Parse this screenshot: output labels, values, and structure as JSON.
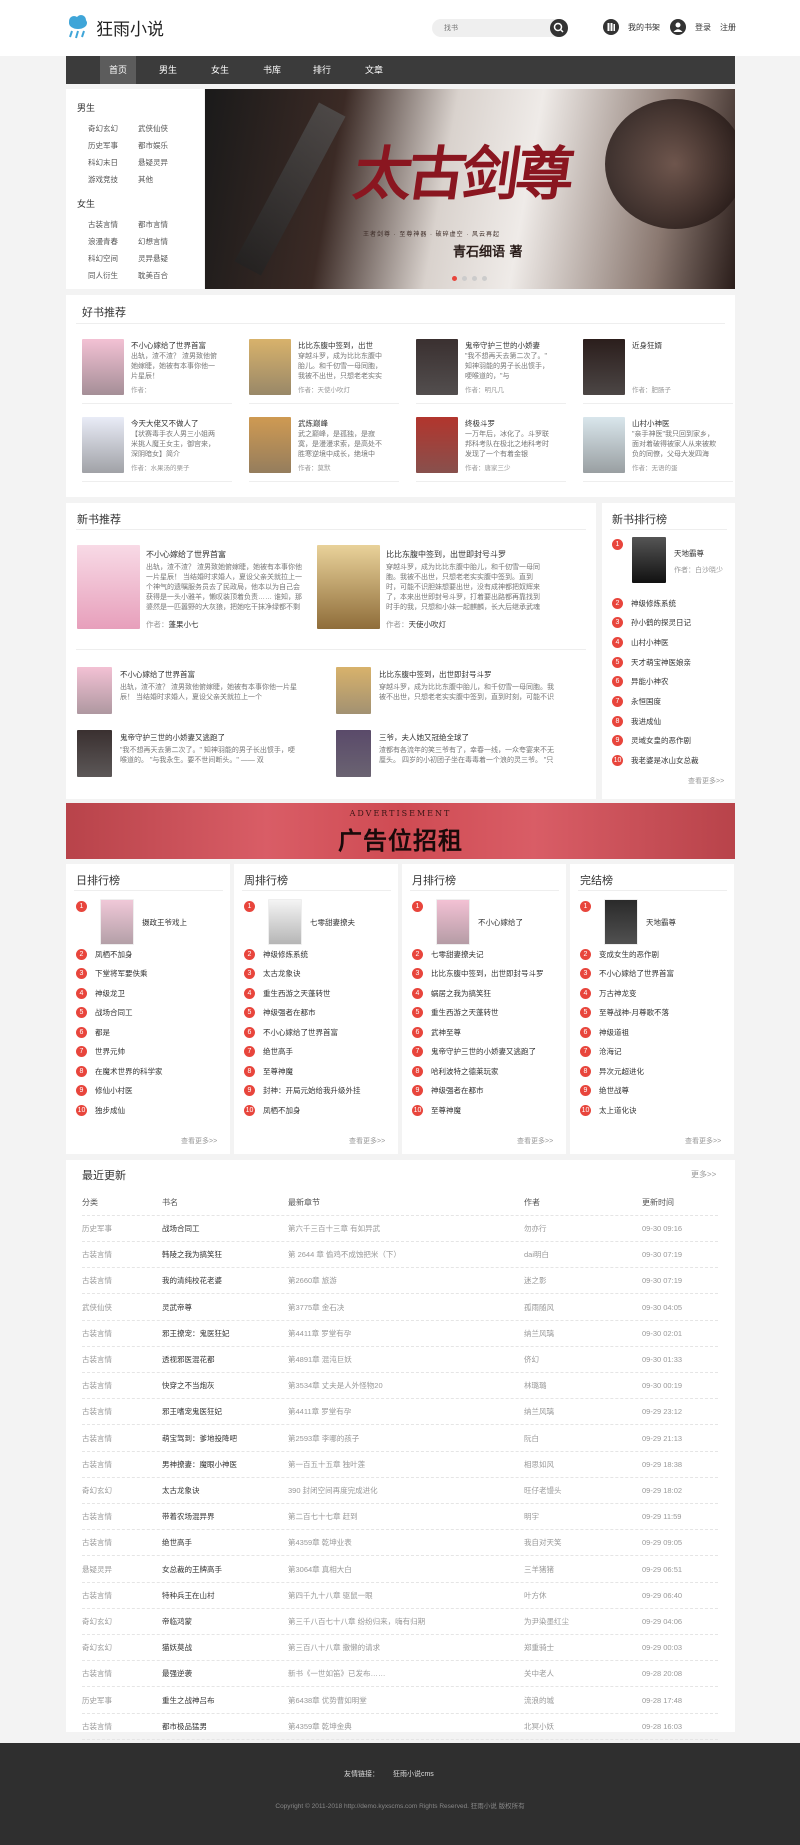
{
  "header": {
    "logo_text": "狂雨小说",
    "search_placeholder": "找书",
    "bookshelf": "我的书架",
    "login": "登录",
    "register": "注册"
  },
  "nav": [
    "首页",
    "男生",
    "女生",
    "书库",
    "排行",
    "文章"
  ],
  "sidebar": {
    "male_title": "男生",
    "male": [
      "奇幻玄幻",
      "武侠仙侠",
      "历史军事",
      "都市娱乐",
      "科幻末日",
      "悬疑灵异",
      "游戏竞技",
      "其他"
    ],
    "female_title": "女生",
    "female": [
      "古装言情",
      "都市言情",
      "浪漫青春",
      "幻想言情",
      "科幻空间",
      "灵异悬疑",
      "同人衍生",
      "耽美百合"
    ]
  },
  "banner": {
    "title_calligraphy": "太古剑尊",
    "tagline": "王者剑尊 · 至尊神器 · 破碎虚空 · 风云再起",
    "author_line": "青石细语 著"
  },
  "recommend": {
    "title": "好书推荐",
    "books": [
      {
        "title": "不小心嫁给了世界首富",
        "excerpt": "出轨，渣不渣？ 渣男致他俯她嫁睫，她被有本事你他一片星辰！",
        "author": "作者：",
        "cover": "#f3c1d4"
      },
      {
        "title": "比比东腹中签到，出世",
        "excerpt": "穿越斗罗，成为比比东腹中胎儿。和千仞雪一母同胞，我被不出世，只想老老实实",
        "author": "作者：天使小吹灯",
        "cover": "#d8b26b"
      },
      {
        "title": "鬼帝守护三世的小娇妻",
        "excerpt": "\"我不想再天去第二次了。\" 知神羽能的男子长出惯手，哽喉道的，\"与",
        "author": "作者：明凡几",
        "cover": "#3a3030"
      },
      {
        "title": "近身狂婿",
        "excerpt": "",
        "author": "作者：肥肠子",
        "cover": "#2b1e1c"
      },
      {
        "title": "今天大佬又不做人了",
        "excerpt": "【状赛毒手衣人男三小姐两米挑人魔王女主，御宫来，深阴暗女】简介",
        "author": "作者：水果汤的栗子",
        "cover": "#e9ecf7"
      },
      {
        "title": "武炼巅峰",
        "excerpt": "武之巅峰，是孤独，是寂寞，是漫漫求索，是高处不胜寒逆境中成长，绝境中",
        "author": "作者：莫默",
        "cover": "#cf9a52"
      },
      {
        "title": "终极斗罗",
        "excerpt": "一万年后，冰化了。斗罗联邦科考队在极北之地科考时发现了一个有着金银",
        "author": "作者：唐家三少",
        "cover": "#b2352d"
      },
      {
        "title": "山村小神医",
        "excerpt": "\"亲手神医\"我只回到家乡，面对着破得被家人从来被欺负的同僚，父母大发四海",
        "author": "作者：无语的蛋",
        "cover": "#d9e6ec"
      }
    ]
  },
  "newbooks": {
    "title": "新书推荐",
    "featured": [
      {
        "title": "不小心嫁给了世界首富",
        "excerpt": "出轨，渣不渣？ 渣男致她俯嫁睫，她被有本事你他一片星辰！ 当结婚时求婚人，夏设父亲关就拉上一个神气的遗嘱服务员去了民政局，他本以为自己会获得是一头小雅羊，懒叹装顶着负责…… 谁知，那婆然是一匹嚣野的大灰狼，把她吃干抹净绿都不剩渣……",
        "author_label": "作者：",
        "author": "蓬果小七",
        "cover": "#f3c1d4"
      },
      {
        "title": "比比东腹中签到，出世即封号斗罗",
        "excerpt": "穿越斗罗，成为比比东腹中胎儿，和千仞雪一母同胞。我被不出世，只想老老实实腹中签到。直到时，可能不识胆妹想要出世，没有成神都把奴辉来了，本来出世即封号斗罗，打着要出路都再靠找到时手的我，只想和小妹一起麒麟，长大后继承武魂殿。",
        "author_label": "作者：",
        "author": "天使小吹灯",
        "cover": "#d8b26b"
      }
    ],
    "list": [
      {
        "title": "不小心嫁给了世界首富",
        "excerpt": "出轨，渣不渣？ 渣男致他俯嫁睫，她被有本事你他一片星辰！ 当结婚时求婚人，夏设父亲关就拉上一个",
        "cover": "#f3c1d4"
      },
      {
        "title": "比比东腹中签到，出世即封号斗罗",
        "excerpt": "穿越斗罗，成为比比东腹中胎儿，和千仞雪一母同胞。我被不出世，只想老老实实腹中签到，直到时刻，可能不识胆",
        "cover": "#d8b26b"
      },
      {
        "title": "鬼帝守护三世的小娇妻又逃跑了",
        "excerpt": "\"我不想再天去第二次了。\" 知神羽能的男子长出惯手，哽喉道的。 \"与我永生。要不世间断头。\" —— 双",
        "cover": "#3a3030"
      },
      {
        "title": "三爷，夫人她又冠绝全球了",
        "excerpt": "渣都有各流年的笑三爷有了，幸春一线，一众夸宴来不无厘头。 四岁的小初团子坐在毒毒着一个浪的灵三爷。 \"只要他对",
        "cover": "#5a4a6a"
      }
    ]
  },
  "newrank": {
    "title": "新书排行榜",
    "top": {
      "title": "天地霸尊",
      "author": "作者：白沙晓少",
      "cover": "#2a2a2a"
    },
    "items": [
      "神级修炼系统",
      "孙小鹤的探灵日记",
      "山村小神医",
      "天才萌宝神医娘亲",
      "异能小神农",
      "永恒国度",
      "我进成仙",
      "灵域女皇的恶作剧",
      "我老婆是冰山女总裁"
    ],
    "more": "查看更多>>"
  },
  "ad": {
    "small": "ADVERTISEMENT",
    "big": "广告位招租"
  },
  "ranks": [
    {
      "title": "日排行榜",
      "top": {
        "title": "摄政王爷戏上",
        "cover": "#f0c8d8"
      },
      "items": [
        "凤栖不加身",
        "下堂将军要佚乘",
        "神级龙卫",
        "战场合同工",
        "都是",
        "世界元帅",
        "在魔术世界的科学家",
        "修仙小村医",
        "独步成仙"
      ],
      "more": "查看更多>>"
    },
    {
      "title": "周排行榜",
      "top": {
        "title": "七零甜妻撩夫",
        "cover": "#f4f4f4"
      },
      "items": [
        "神级修炼系统",
        "太古龙象诀",
        "重生西游之天蓬转世",
        "神级强者在都市",
        "不小心嫁给了世界首富",
        "绝世高手",
        "至尊神魔",
        "封神：开局元始给我升级外挂",
        "凤栖不加身"
      ],
      "more": "查看更多>>"
    },
    {
      "title": "月排行榜",
      "top": {
        "title": "不小心嫁给了",
        "cover": "#f3c1d4"
      },
      "items": [
        "七零甜妻撩夫记",
        "比比东腹中签到，出世即封号斗罗",
        "蜗居之我为搞笑狂",
        "重生西游之天蓬转世",
        "武神至尊",
        "鬼帝守护三世的小娇妻又逃跑了",
        "哈利波特之德莱玩家",
        "神级强者在都市",
        "至尊神魔"
      ],
      "more": "查看更多>>"
    },
    {
      "title": "完结榜",
      "top": {
        "title": "天地霸尊",
        "cover": "#2a2a2a"
      },
      "items": [
        "变成女生的恶作剧",
        "不小心嫁给了世界首富",
        "万古神龙变",
        "至尊战神-月尊歌不落",
        "神级道祖",
        "沧海记",
        "异次元超进化",
        "绝世战尊",
        "太上道化诀"
      ],
      "more": "查看更多>>"
    }
  ],
  "updates": {
    "title": "最近更新",
    "more": "更多>>",
    "headers": [
      "分类",
      "书名",
      "最新章节",
      "作者",
      "更新时间"
    ],
    "rows": [
      [
        "历史军事",
        "战场合同工",
        "第六千三百十三章 有如异武",
        "勿亦行",
        "09-30 09:16"
      ],
      [
        "古装言情",
        "韩陵之我为搞笑狂",
        "第 2644 章 偷鸡不成蚀把米（下）",
        "dai明白",
        "09-30 07:19"
      ],
      [
        "古装言情",
        "我的清纯校花老婆",
        "第2660章 旅游",
        "迷之影",
        "09-30 07:19"
      ],
      [
        "武侠仙侠",
        "灵武帝尊",
        "第3775章 金石决",
        "孤雨随风",
        "09-30 04:05"
      ],
      [
        "古装言情",
        "邪王撩宠：鬼医狂妃",
        "第4411章 罗堂有孕",
        "纳兰风璃",
        "09-30 02:01"
      ],
      [
        "古装言情",
        "透视邪医混花都",
        "第4891章 混沌巨妖",
        "侪幻",
        "09-30 01:33"
      ],
      [
        "古装言情",
        "快穿之不当炮灰",
        "第3534章 丈夫是人外怪物20",
        "林璐璐",
        "09-30 00:19"
      ],
      [
        "古装言情",
        "邪王嗜宠鬼医狂妃",
        "第4411章 罗堂有孕",
        "纳兰风璃",
        "09-29 23:12"
      ],
      [
        "古装言情",
        "萌宝驾到：爹地投降吧",
        "第2593章 李哪的孩子",
        "阮白",
        "09-29 21:13"
      ],
      [
        "古装言情",
        "男神撩妻：魔眼小神医",
        "第一百五十五章 独叶莲",
        "相思如风",
        "09-29 18:38"
      ],
      [
        "奇幻玄幻",
        "太古龙象诀",
        "390 封闭空间再度完成进化",
        "旺仔老馒头",
        "09-29 18:02"
      ],
      [
        "古装言情",
        "带着农场混异界",
        "第二百七十七章 赶到",
        "明宇",
        "09-29 11:59"
      ],
      [
        "古装言情",
        "绝世高手",
        "第4359章 乾坤业表",
        "我自对天笑",
        "09-29 09:05"
      ],
      [
        "悬疑灵异",
        "女总裁的王牌高手",
        "第3064章 真相大白",
        "三羊猪猪",
        "09-29 06:51"
      ],
      [
        "古装言情",
        "特种兵王在山村",
        "第四千九十八章 驱鼠一眼",
        "叶方休",
        "09-29 06:40"
      ],
      [
        "奇幻玄幻",
        "帝临鸿蒙",
        "第三千八百七十八章 纷纷归来，嗨有归期",
        "为尹染墨红尘",
        "09-29 04:06"
      ],
      [
        "奇幻玄幻",
        "猫妖莫战",
        "第三百八十八章 撒懒的请求",
        "郑重骑士",
        "09-29 00:03"
      ],
      [
        "古装言情",
        "最强逆袭",
        "新书《一世如笛》已发布……",
        "关中老人",
        "09-28 20:08"
      ],
      [
        "历史军事",
        "重生之战神吕布",
        "第6438章 优势曹如明堂",
        "流浪的城",
        "09-28 17:48"
      ],
      [
        "古装言情",
        "都市极品猛男",
        "第4359章 乾坤金典",
        "北冥小妖",
        "09-28 16:03"
      ]
    ]
  },
  "footer": {
    "links_label": "友情链接：",
    "links": [
      "狂雨小说cms"
    ],
    "copyright": "Copyright © 2011-2018 http://demo.kyxscms.com Rights Reserved. 狂雨小说 版权所有"
  },
  "colors": {
    "accent": "#e8453c",
    "nav_bg": "#3b3b3b",
    "nav_active": "#5c5c5c",
    "ad_bg": "#cf4b53",
    "footer_bg": "#2f2f2f"
  }
}
